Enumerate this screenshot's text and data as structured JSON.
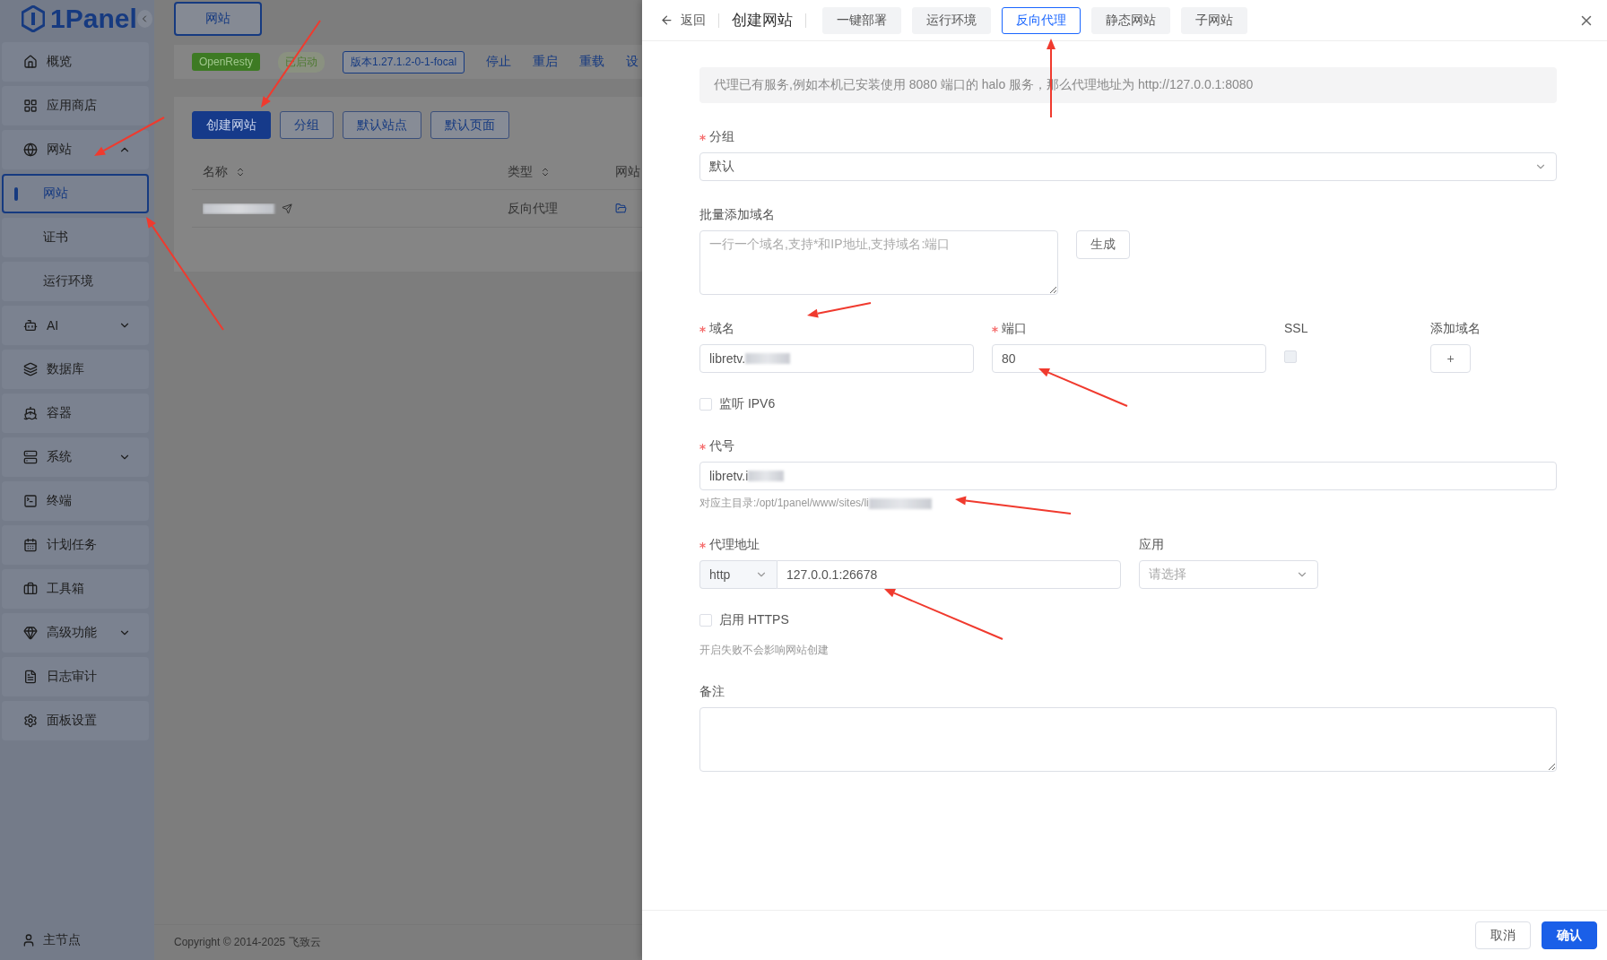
{
  "sidebar": {
    "logo": "1Panel",
    "items": [
      {
        "label": "概览",
        "selected": false
      },
      {
        "label": "应用商店",
        "selected": false
      },
      {
        "label": "网站",
        "selected": false,
        "expanded": true,
        "children": [
          {
            "label": "网站",
            "selected": true
          },
          {
            "label": "证书",
            "selected": false
          },
          {
            "label": "运行环境",
            "selected": false
          }
        ]
      },
      {
        "label": "AI",
        "selected": false,
        "expanded": false
      },
      {
        "label": "数据库",
        "selected": false
      },
      {
        "label": "容器",
        "selected": false
      },
      {
        "label": "系统",
        "selected": false,
        "expanded": false
      },
      {
        "label": "终端",
        "selected": false
      },
      {
        "label": "计划任务",
        "selected": false
      },
      {
        "label": "工具箱",
        "selected": false
      },
      {
        "label": "高级功能",
        "selected": false,
        "expanded": false
      },
      {
        "label": "日志审计",
        "selected": false
      },
      {
        "label": "面板设置",
        "selected": false
      }
    ],
    "node": "主节点"
  },
  "main": {
    "tab": "网站",
    "status": {
      "app": "OpenResty",
      "state": "已启动",
      "version": "版本1.27.1.2-0-1-focal",
      "actions": [
        "停止",
        "重启",
        "重载",
        "设"
      ]
    },
    "toolbar": [
      {
        "label": "创建网站",
        "primary": true
      },
      {
        "label": "分组",
        "primary": false
      },
      {
        "label": "默认站点",
        "primary": false
      },
      {
        "label": "默认页面",
        "primary": false
      }
    ],
    "table": {
      "columns": [
        "名称",
        "类型",
        "网站"
      ],
      "rows": [
        {
          "type": "反向代理"
        }
      ]
    },
    "footer": "Copyright © 2014-2025 飞致云"
  },
  "drawer": {
    "back": "返回",
    "title": "创建网站",
    "tabs": [
      {
        "label": "一键部署",
        "selected": false
      },
      {
        "label": "运行环境",
        "selected": false
      },
      {
        "label": "反向代理",
        "selected": true
      },
      {
        "label": "静态网站",
        "selected": false
      },
      {
        "label": "子网站",
        "selected": false
      }
    ],
    "alert": "代理已有服务,例如本机已安装使用 8080 端口的 halo 服务，那么代理地址为 http://127.0.0.1:8080",
    "group": {
      "label": "分组",
      "required": true,
      "value": "默认"
    },
    "batch_domains": {
      "label": "批量添加域名",
      "placeholder": "一行一个域名,支持*和IP地址,支持域名:端口",
      "button": "生成"
    },
    "domain": {
      "label": "域名",
      "required": true,
      "value": "libretv."
    },
    "port": {
      "label": "端口",
      "required": true,
      "value": "80"
    },
    "ssl": {
      "label": "SSL",
      "checked": false,
      "disabled": true
    },
    "add_domain": {
      "label": "添加域名",
      "button": "+"
    },
    "ipv6": {
      "label": "监听 IPV6",
      "checked": false
    },
    "alias": {
      "label": "代号",
      "required": true,
      "value": "libretv.i",
      "hint": "对应主目录:/opt/1panel/www/sites/li"
    },
    "proxy": {
      "label": "代理地址",
      "required": true,
      "scheme": "http",
      "value": "127.0.0.1:26678"
    },
    "app": {
      "label": "应用",
      "placeholder": "请选择"
    },
    "https": {
      "label": "启用 HTTPS",
      "checked": false,
      "hint": "开启失败不会影响网站创建"
    },
    "remark": {
      "label": "备注"
    },
    "cancel": "取消",
    "confirm": "确认"
  }
}
